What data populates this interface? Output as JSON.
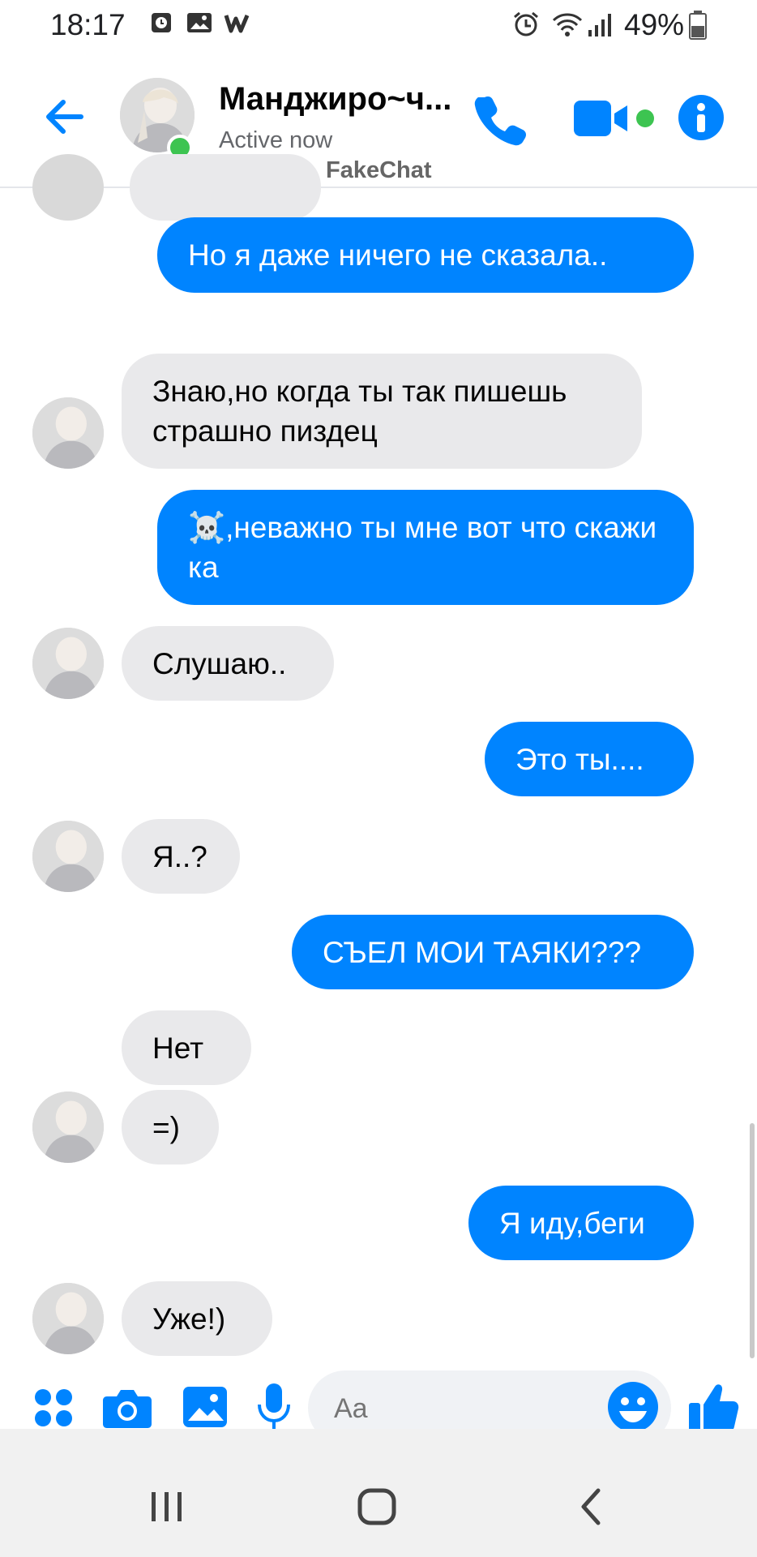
{
  "status_bar": {
    "time": "18:17",
    "battery": "49%",
    "icons": [
      "clock-app-icon",
      "gallery-icon",
      "wattpad-icon",
      "alarm-icon",
      "wifi-icon",
      "signal-icon",
      "battery-icon"
    ]
  },
  "header": {
    "contact_name": "Манджиро~ч...",
    "status": "Active now",
    "watermark": "FakeChat",
    "icons": [
      "back-arrow-icon",
      "phone-icon",
      "video-camera-icon",
      "info-icon"
    ],
    "accent_color": "#0084ff",
    "online_color": "#3dc451"
  },
  "messages": [
    {
      "side": "out",
      "text": "Но я даже ничего не сказала.."
    },
    {
      "side": "in",
      "text": "Знаю,но когда ты так пишешь страшно пиздец"
    },
    {
      "side": "out",
      "text": "☠️,неважно ты мне вот что скажи ка"
    },
    {
      "side": "in",
      "text": "Слушаю.."
    },
    {
      "side": "out",
      "text": "Это ты...."
    },
    {
      "side": "in",
      "text": "Я..?"
    },
    {
      "side": "out",
      "text": "СЪЕЛ МОИ ТАЯКИ???"
    },
    {
      "side": "in",
      "text": "Нет"
    },
    {
      "side": "in",
      "text": "=)"
    },
    {
      "side": "out",
      "text": "Я иду,беги"
    },
    {
      "side": "in",
      "text": "Уже!)"
    }
  ],
  "composer": {
    "placeholder": "Aa",
    "icons": [
      "apps-grid-icon",
      "camera-icon",
      "image-icon",
      "microphone-icon",
      "emoji-icon",
      "thumbs-up-icon"
    ]
  },
  "nav_bar": {
    "icons": [
      "recents-icon",
      "home-icon",
      "back-icon"
    ]
  }
}
